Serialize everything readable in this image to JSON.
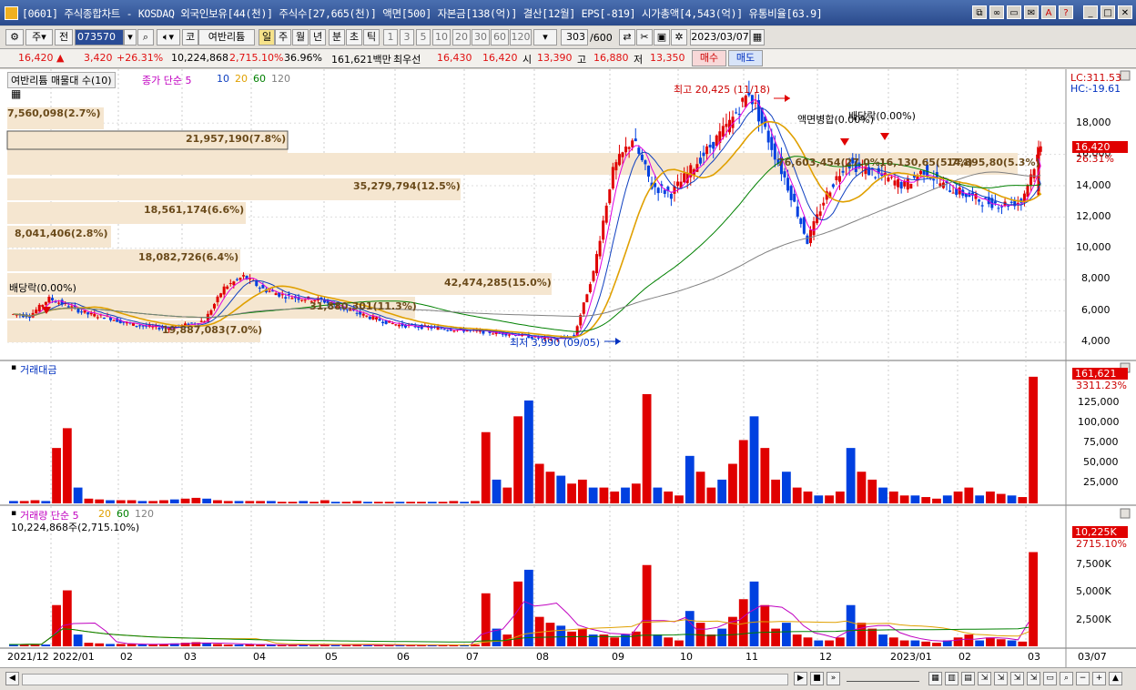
{
  "window": {
    "title": "[0601] 주식종합차트 - KOSDAQ 외국인보유[44(천)] 주식수[27,665(천)] 액면[500] 자본금[138(억)] 결산[12월] EPS[-819] 시가총액[4,543(억)] 유통비율[63.9]",
    "buttons": [
      "⧉",
      "?",
      "□",
      "✉",
      "A",
      "?",
      "_",
      "□",
      "X"
    ]
  },
  "toolbar": {
    "week_label": "주",
    "prev_label": "전",
    "code_value": "073570",
    "stock_type": "코",
    "stock_name": "여반리튬",
    "periods": [
      "일",
      "주",
      "월",
      "년",
      "분",
      "초",
      "틱"
    ],
    "selected_period": "일",
    "intervals": [
      "1",
      "3",
      "5",
      "10",
      "20",
      "30",
      "60",
      "120"
    ],
    "count_value": "303",
    "count_total": "/600",
    "date_value": "2023/03/07"
  },
  "quote": {
    "price": "16,420",
    "arrow": "▲",
    "change": "3,420",
    "change_pct": "+26.31%",
    "volume": "10,224,868",
    "volume_pct": "2,715.10%",
    "turnover": "36.96%",
    "amount": "161,621백만",
    "best_label": "최우선",
    "ask": "16,430",
    "bid": "16,420",
    "open_label": "시",
    "open": "13,390",
    "high_label": "고",
    "high": "16,880",
    "low_label": "저",
    "low": "13,350",
    "buy_label": "매수",
    "sell_label": "매도"
  },
  "price_panel": {
    "legend_item": "여반리튬 매물대 수(10)",
    "ma_label": "종가 단순 5",
    "ma_periods": [
      "10",
      "20",
      "60",
      "120"
    ],
    "ma_colors": [
      "#e000e0",
      "#1040c0",
      "#e0a000",
      "#008000",
      "#808080"
    ],
    "lc": "LC:311.53",
    "hc": "HC:-19.61",
    "y_ticks": [
      "18,000",
      "16,000",
      "14,000",
      "12,000",
      "10,000",
      "8,000",
      "6,000",
      "4,000"
    ],
    "price_tag": "16,420",
    "pct_tag": "26.31%",
    "high_note": "최고 20,425 (11/18)",
    "low_note": "최저 3,990 (09/05)",
    "event_dividend1": "배당락(0.00%)",
    "event_dividend2": "배당락(0.00%)",
    "event_split": "액면병합(0.00%)",
    "volume_profile": [
      "7,560,098(2.7%)",
      "21,957,190(7.8%)",
      "76,603,454(27.0%)",
      "35,279,794(12.5%)",
      "18,561,174(6.6%)",
      "8,041,406(2.8%)",
      "18,082,726(6.4%)",
      "42,474,285(15.0%)",
      "31,880,301(11.3%)",
      "19,887,083(7.0%)"
    ],
    "profile_right_note": "16,130,65(5.7%)",
    "profile_right_note2": "14,895,80(5.3%)"
  },
  "amount_panel": {
    "title": "거래대금",
    "tag": "161,621",
    "pct_tag": "3311.23%",
    "y_ticks": [
      "125,000",
      "100,000",
      "75,000",
      "50,000",
      "25,000"
    ]
  },
  "volume_panel": {
    "title": "거래량 단순 5",
    "ma_periods": [
      "20",
      "60",
      "120"
    ],
    "current": "10,224,868주(2,715.10%)",
    "tag": "10,225K",
    "pct_tag": "2715.10%",
    "y_ticks": [
      "7,500K",
      "5,000K",
      "2,500K"
    ]
  },
  "x_axis": {
    "labels": [
      "2021/12",
      "2022/01",
      "02",
      "03",
      "04",
      "05",
      "06",
      "07",
      "08",
      "09",
      "10",
      "11",
      "12",
      "2023/01",
      "02",
      "03",
      "03/07"
    ]
  },
  "chart_data": {
    "type": "candlestick",
    "y_price_range": [
      3000,
      19500
    ],
    "x_months": [
      "2021/12",
      "2022/01",
      "02",
      "03",
      "04",
      "05",
      "06",
      "07",
      "08",
      "09",
      "10",
      "11",
      "12",
      "2023/01",
      "02",
      "03"
    ],
    "close_series": [
      5800,
      5700,
      6800,
      6300,
      5800,
      5600,
      5200,
      5000,
      4900,
      5100,
      5400,
      7500,
      8200,
      7400,
      7000,
      6800,
      6700,
      6200,
      5800,
      5400,
      5100,
      5000,
      4900,
      4800,
      4700,
      4600,
      4500,
      4300,
      4200,
      4400,
      8500,
      15000,
      17000,
      14000,
      13500,
      15000,
      16500,
      18000,
      20000,
      17000,
      14000,
      10500,
      13500,
      15500,
      15000,
      14500,
      14000,
      15000,
      14000,
      13500,
      13000,
      12800,
      13000,
      16420
    ],
    "last": {
      "open": 13390,
      "high": 16880,
      "low": 13350,
      "close": 16420,
      "volume": 10224868
    }
  }
}
